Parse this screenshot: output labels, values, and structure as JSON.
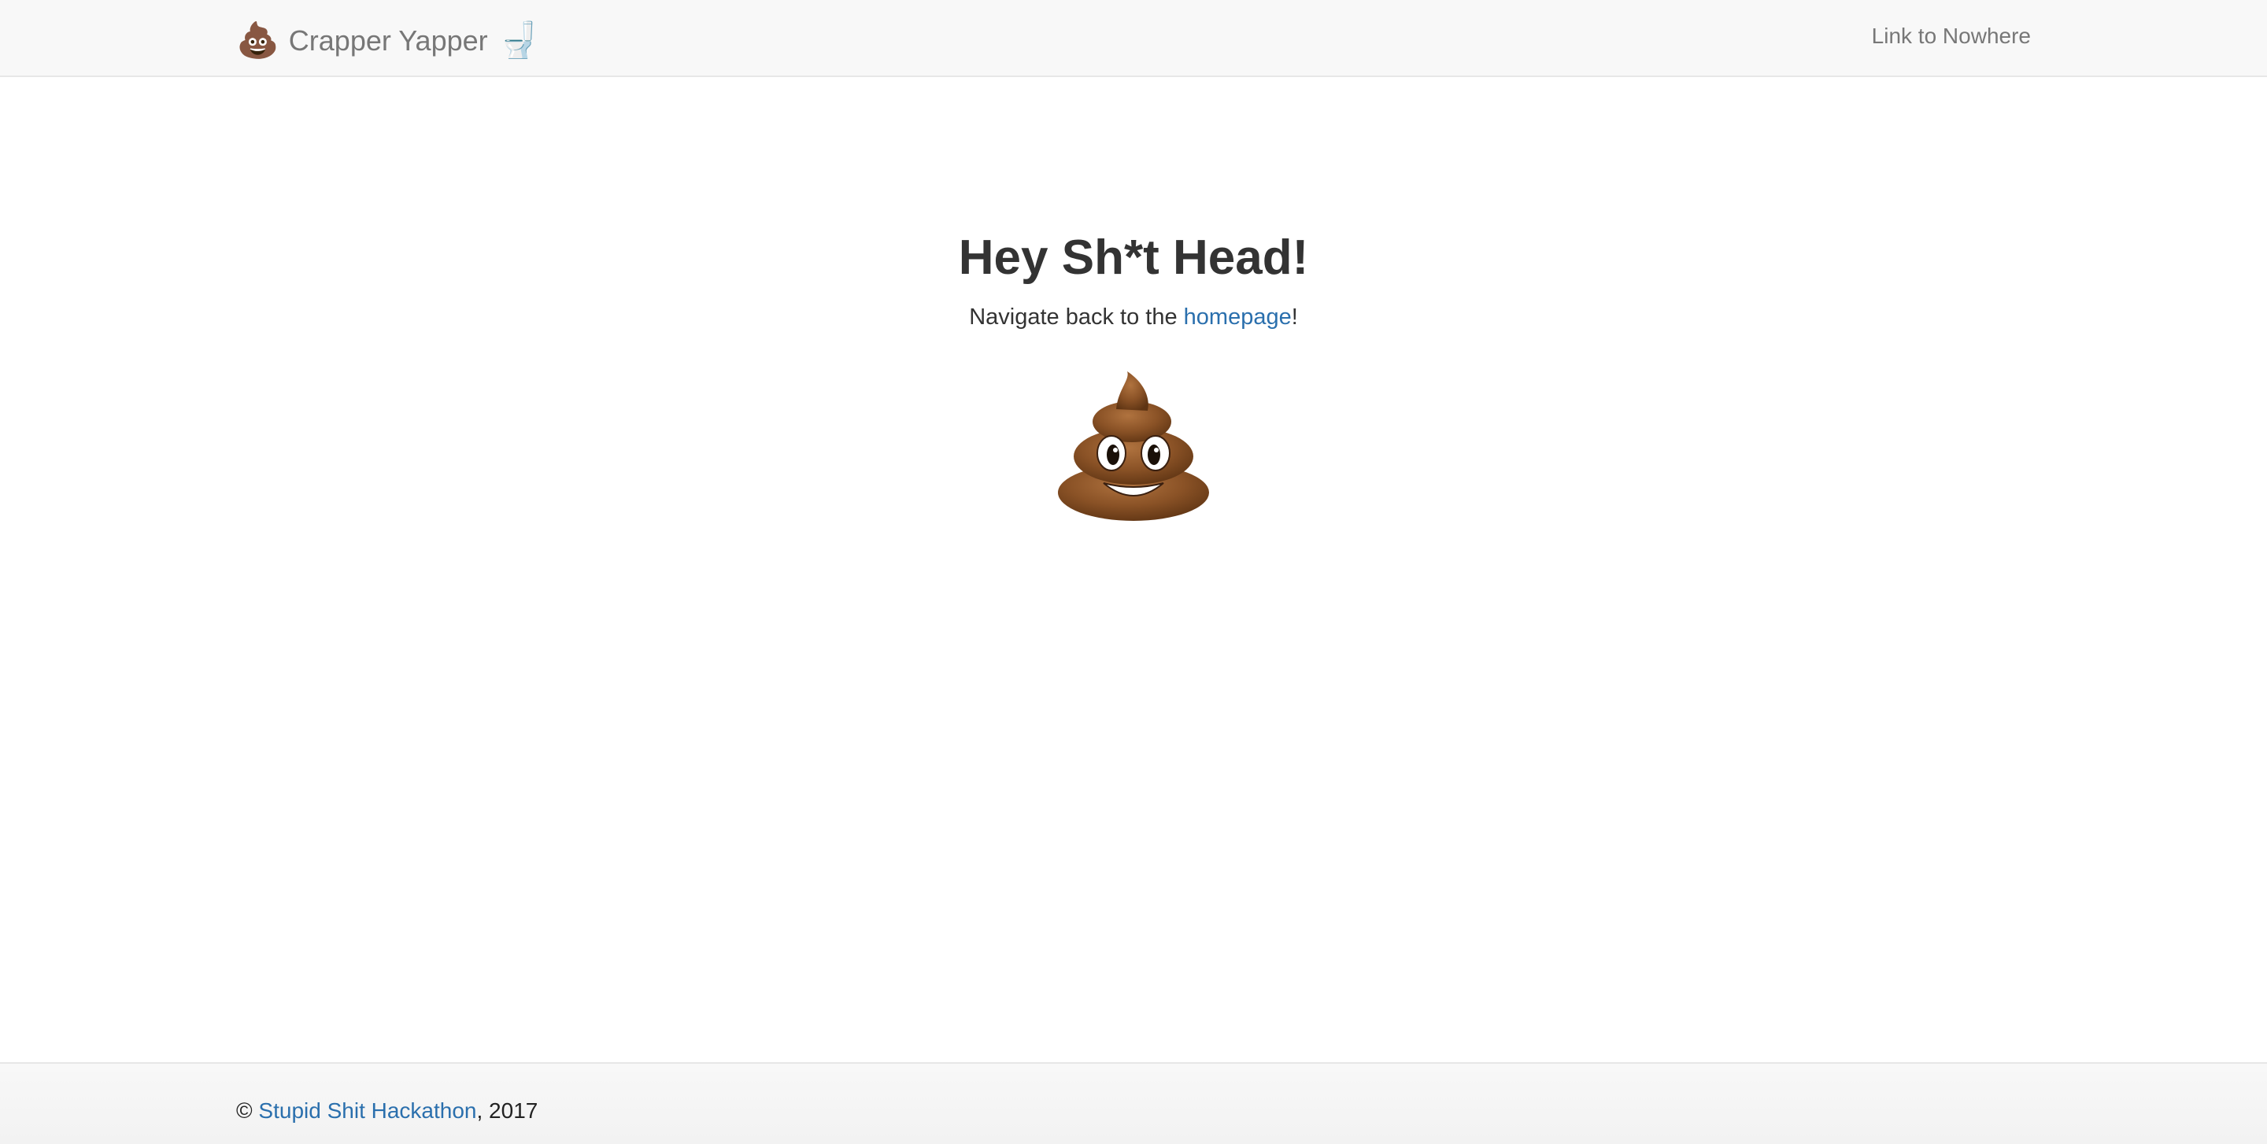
{
  "navbar": {
    "brand_emoji_left": "💩",
    "brand_text": "Crapper Yapper",
    "brand_emoji_right": "🚽",
    "link_label": "Link to Nowhere"
  },
  "main": {
    "title": "Hey Sh*t Head!",
    "subtitle_prefix": "Navigate back to the ",
    "subtitle_link": "homepage",
    "subtitle_suffix": "!",
    "hero_icon": "pile-of-poo-icon"
  },
  "footer": {
    "copyright_symbol": "©",
    "link_label": "Stupid Shit Hackathon",
    "year_suffix": ", 2017"
  },
  "colors": {
    "navbar_bg": "#f8f8f8",
    "link": "#2a6fad",
    "nav_text": "#777777",
    "heading": "#333333"
  }
}
